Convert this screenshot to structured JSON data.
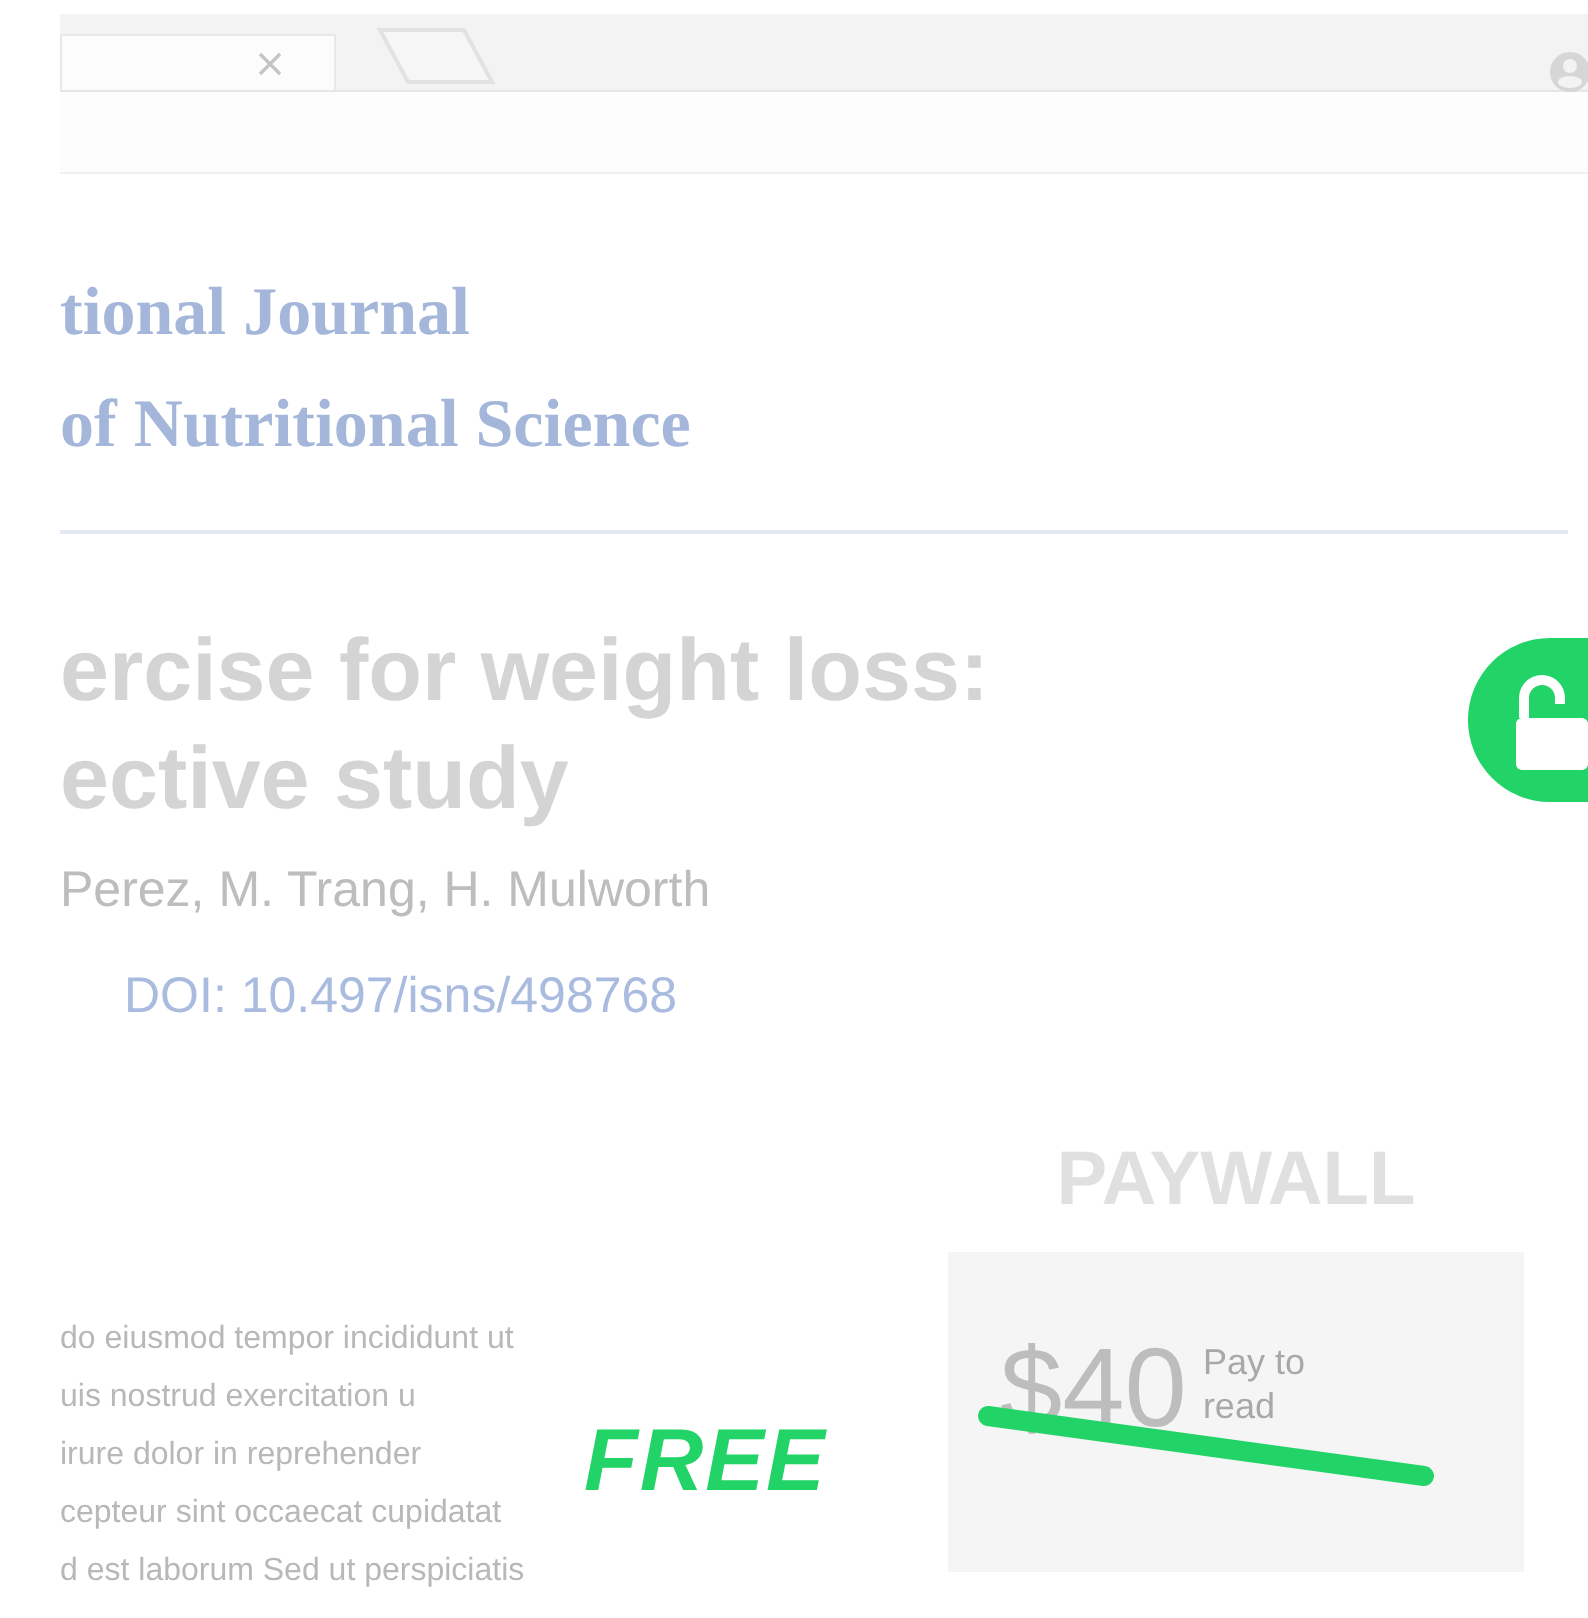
{
  "journal": {
    "lines": [
      "tional Journal",
      "of Nutritional Science"
    ]
  },
  "article": {
    "title_lines": [
      "ercise for weight loss:",
      "ective study"
    ],
    "authors": "Perez, M. Trang, H. Mulworth",
    "doi": "DOI: 10.497/isns/498768"
  },
  "body_lines": [
    "do eiusmod tempor incididunt ut",
    "uis nostrud exercitation u",
    "irure dolor in reprehender",
    "cepteur sint occaecat cupidatat",
    "d est laborum Sed ut perspiciatis"
  ],
  "paywall": {
    "heading": "PAYWALL",
    "price": "$40",
    "action": "Pay to read"
  },
  "overlay": {
    "label": "FREE"
  }
}
